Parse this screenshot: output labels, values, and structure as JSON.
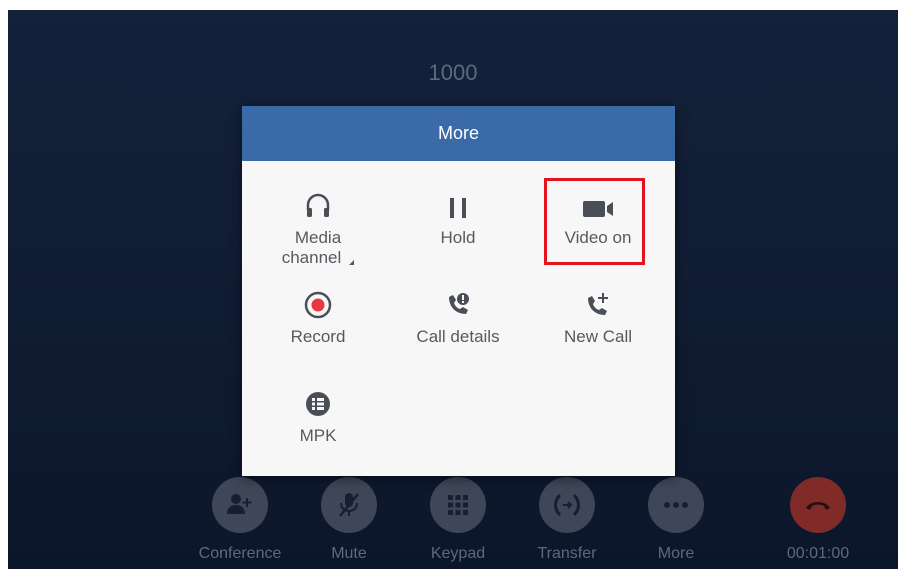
{
  "call": {
    "number": "1000",
    "duration": "00:01:00"
  },
  "controls": [
    {
      "label": "Conference",
      "icon": "add-person-icon"
    },
    {
      "label": "Mute",
      "icon": "mic-off-icon"
    },
    {
      "label": "Keypad",
      "icon": "keypad-icon"
    },
    {
      "label": "Transfer",
      "icon": "transfer-icon"
    },
    {
      "label": "More",
      "icon": "more-dots-icon"
    },
    {
      "label": "00:01:00",
      "icon": "hang-up-icon"
    }
  ],
  "popup": {
    "title": "More",
    "items": [
      {
        "label_line1": "Media",
        "label_line2": "channel",
        "icon": "headset-icon"
      },
      {
        "label": "Hold",
        "icon": "pause-icon"
      },
      {
        "label": "Video on",
        "icon": "video-camera-icon"
      },
      {
        "label": "Record",
        "icon": "record-icon"
      },
      {
        "label": "Call details",
        "icon": "call-details-icon"
      },
      {
        "label": "New Call",
        "icon": "new-call-icon"
      },
      {
        "label": "MPK",
        "icon": "mpk-icon"
      }
    ]
  },
  "colors": {
    "header": "#3b6aa8",
    "highlight": "#e3141b",
    "record": "#e8383b",
    "hangup": "#c0392b"
  }
}
